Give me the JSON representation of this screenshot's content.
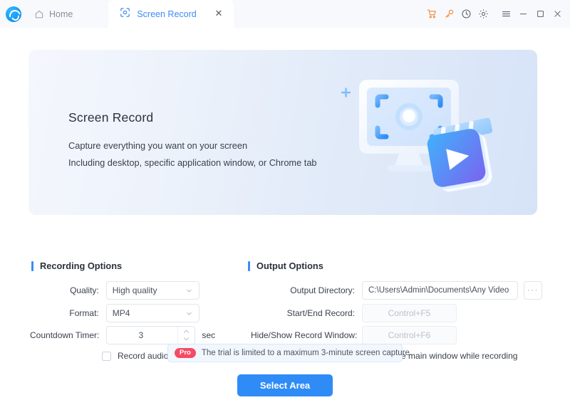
{
  "titlebar": {
    "app_logo_name": "app-logo",
    "home_label": "Home",
    "tab": {
      "label": "Screen Record",
      "close_label": "✕"
    },
    "icons": [
      {
        "name": "cart-icon",
        "color": "#f5862c"
      },
      {
        "name": "key-icon",
        "color": "#f5862c"
      },
      {
        "name": "history-clock-icon",
        "color": "#5b6272"
      },
      {
        "name": "gear-icon",
        "color": "#5b6272"
      },
      {
        "name": "menu-hamburger-icon",
        "color": "#5b6272"
      },
      {
        "name": "minimize-icon",
        "color": "#5b6272"
      },
      {
        "name": "maximize-icon",
        "color": "#5b6272"
      },
      {
        "name": "close-icon",
        "color": "#5b6272"
      }
    ]
  },
  "hero": {
    "title": "Screen Record",
    "line1": "Capture everything you want on your screen",
    "line2": "Including desktop, specific application window, or Chrome tab",
    "gradient_from": "#f4f7fd",
    "gradient_to": "#d6e3f7"
  },
  "recording_options": {
    "section_title": "Recording Options",
    "quality": {
      "label": "Quality:",
      "value": "High quality"
    },
    "format": {
      "label": "Format:",
      "value": "MP4"
    },
    "countdown": {
      "label": "Countdown Timer:",
      "value": "3",
      "unit": "sec"
    },
    "record_audio": {
      "label": "Record audio",
      "checked": false
    }
  },
  "output_options": {
    "section_title": "Output Options",
    "output_directory": {
      "label": "Output Directory:",
      "value": "C:\\Users\\Admin\\Documents\\Any Video C",
      "browse_label": "···"
    },
    "start_end_record": {
      "label": "Start/End Record:",
      "value": "Control+F5"
    },
    "hide_show_window": {
      "label": "Hide/Show Record Window:",
      "value": "Control+F6"
    },
    "hide_main_window": {
      "label": "Hide the main window while recording",
      "checked": false
    }
  },
  "pro_banner": {
    "badge": "Pro",
    "text": "The trial is limited to a maximum 3-minute screen capture.",
    "badge_color": "#f64b63"
  },
  "action": {
    "select_area_label": "Select Area",
    "accent_color": "#2f8cf7"
  }
}
